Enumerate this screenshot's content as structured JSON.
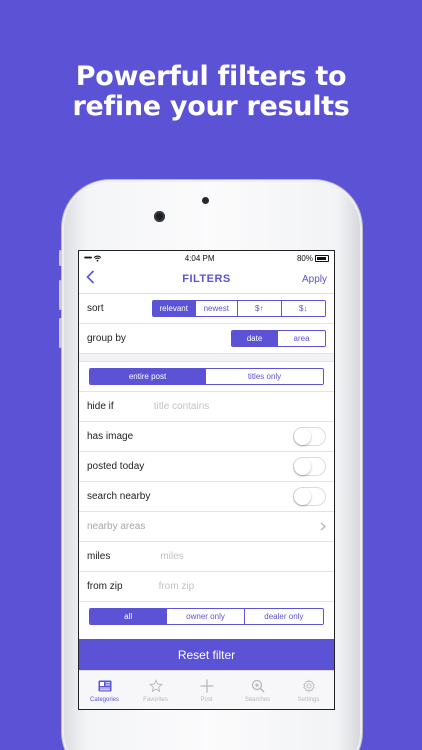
{
  "headline": {
    "line1": "Powerful filters to",
    "line2": "refine your results"
  },
  "status_bar": {
    "carrier_dots": "•••••",
    "time": "4:04 PM",
    "battery": "80%"
  },
  "nav": {
    "back_icon": "chevron-left-icon",
    "title": "FILTERS",
    "apply": "Apply"
  },
  "sort": {
    "label": "sort",
    "options": [
      "relevant",
      "newest",
      "$↑",
      "$↓"
    ],
    "selected": "relevant"
  },
  "group_by": {
    "label": "group by",
    "options": [
      "date",
      "area"
    ],
    "selected": "date"
  },
  "search_scope": {
    "options": [
      "entire post",
      "titles only"
    ],
    "selected": "entire post"
  },
  "hide_if": {
    "label": "hide if",
    "placeholder": "title contains"
  },
  "has_image": {
    "label": "has image",
    "on": false
  },
  "posted_today": {
    "label": "posted today",
    "on": false
  },
  "search_nearby": {
    "label": "search nearby",
    "on": false
  },
  "nearby_areas": {
    "label": "nearby areas"
  },
  "miles": {
    "label": "miles",
    "placeholder": "miles"
  },
  "from_zip": {
    "label": "from zip",
    "placeholder": "from zip"
  },
  "seller_type": {
    "options": [
      "all",
      "owner only",
      "dealer only"
    ],
    "selected": "all"
  },
  "reset_button": "Reset filter",
  "tabs": [
    {
      "label": "Categories",
      "icon": "categories-icon",
      "active": true
    },
    {
      "label": "Favorites",
      "icon": "star-icon",
      "active": false
    },
    {
      "label": "Post",
      "icon": "plus-icon",
      "active": false
    },
    {
      "label": "Searches",
      "icon": "search-icon",
      "active": false
    },
    {
      "label": "Settings",
      "icon": "gear-icon",
      "active": false
    }
  ],
  "colors": {
    "accent": "#5b52d6",
    "background": "#5b52d6"
  }
}
